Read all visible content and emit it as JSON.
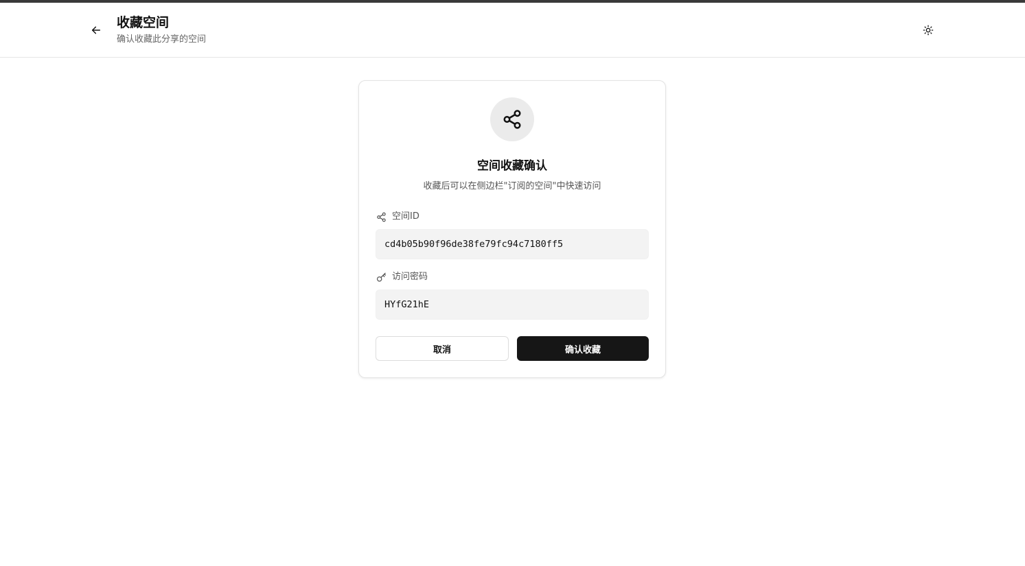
{
  "header": {
    "title": "收藏空间",
    "subtitle": "确认收藏此分享的空间",
    "back_icon": "arrow-left-icon",
    "theme_icon": "sun-icon"
  },
  "card": {
    "icon": "share-icon",
    "title": "空间收藏确认",
    "description": "收藏后可以在侧边栏\"订阅的空间\"中快速访问",
    "space_id": {
      "label": "空间ID",
      "icon": "share-icon",
      "value": "cd4b05b90f96de38fe79fc94c7180ff5"
    },
    "password": {
      "label": "访问密码",
      "icon": "key-icon",
      "value": "HYfG21hE"
    },
    "cancel_label": "取消",
    "confirm_label": "确认收藏"
  },
  "colors": {
    "primary_button": "#161616",
    "input_bg": "#f3f3f3",
    "icon_circle_bg": "#ebebeb"
  }
}
